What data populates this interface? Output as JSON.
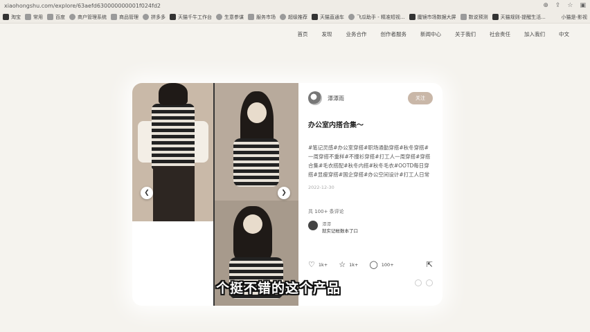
{
  "browser": {
    "url": "xiaohongshu.com/explore/63aefd630000000001f024fd2",
    "bookmarks": [
      "淘宝",
      "常用",
      "百度",
      "商户管理系统",
      "商品管理",
      "拼多多",
      "天猫千牛工作台",
      "生意参谋",
      "服务市场",
      "超级推荐",
      "天猫直通车",
      "飞瓜助手 - 精准短视...",
      "魔镜市场数据大屏",
      "数说预测",
      "天猫规则-提醒生活..."
    ],
    "bookmarks_more": "小猫是-影视"
  },
  "site_nav": [
    "首页",
    "发现",
    "业务合作",
    "创作者服务",
    "新闻中心",
    "关于我们",
    "社会责任",
    "加入我们",
    "中文"
  ],
  "note": {
    "author": "潭潭雨",
    "follow_label": "关注",
    "title": "办公室内搭合集～",
    "tags": "#笔记灵感#办公室穿搭#职场通勤穿搭#秋冬穿搭#一周穿搭不重样#不撞衫穿搭#打工人一周穿搭#穿搭合集#毛衣搭配#秋冬内搭#秋冬毛衣#OOTD每日穿搭#显瘦穿搭#国企穿搭#办公空间设计#打工人日常",
    "date": "2022-12-30",
    "comment_count": "共 100+ 条评论",
    "comment": {
      "user": "潭潭",
      "text": "就实记帐数本了口"
    },
    "likes": "1k+",
    "collects": "1k+",
    "comments_short": "100+"
  },
  "subtitle": "个挺不错的这个产品"
}
